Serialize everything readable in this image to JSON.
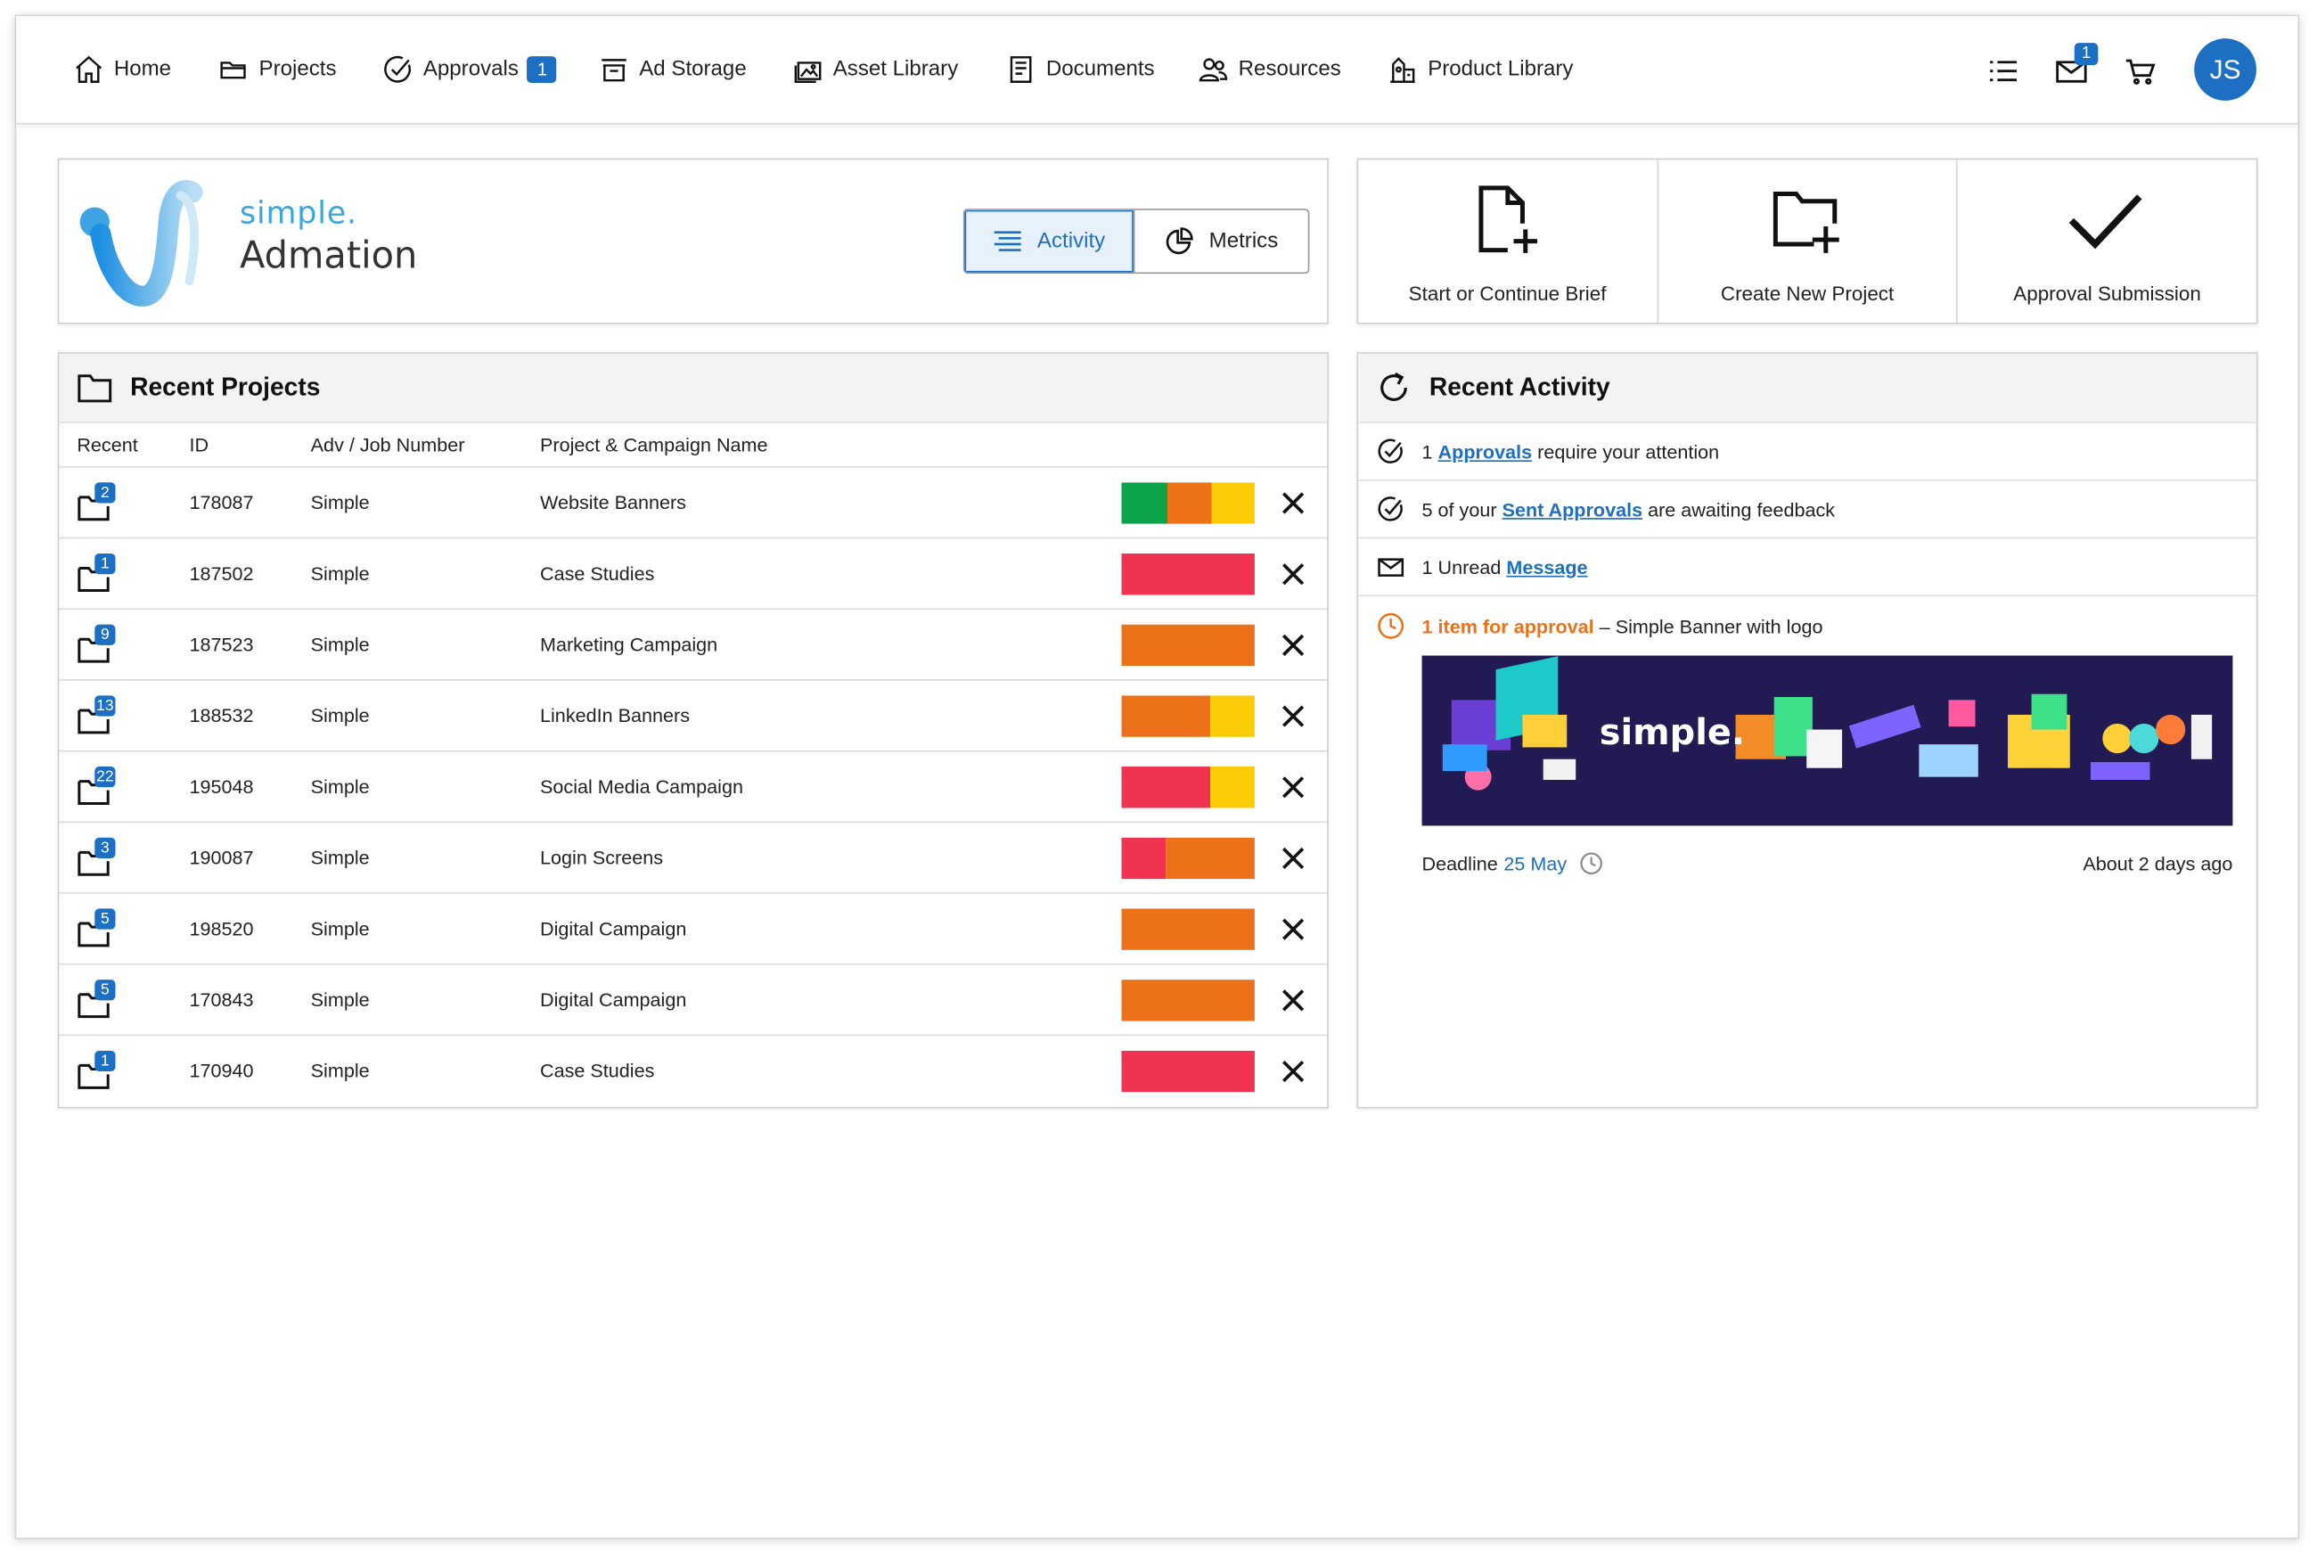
{
  "nav": {
    "items": [
      {
        "label": "Home",
        "icon": "home-icon"
      },
      {
        "label": "Projects",
        "icon": "folder-open-icon"
      },
      {
        "label": "Approvals",
        "icon": "check-circle-icon",
        "badge": "1"
      },
      {
        "label": "Ad Storage",
        "icon": "storage-box-icon"
      },
      {
        "label": "Asset Library",
        "icon": "image-stack-icon"
      },
      {
        "label": "Documents",
        "icon": "document-icon"
      },
      {
        "label": "Resources",
        "icon": "people-icon"
      },
      {
        "label": "Product Library",
        "icon": "product-icon"
      }
    ],
    "messages_badge": "1",
    "avatar_initials": "JS",
    "accent_color": "#1c6fc2"
  },
  "brand": {
    "word_top": "simple.",
    "word_bottom": "Admation"
  },
  "view_toggle": {
    "activity_label": "Activity",
    "metrics_label": "Metrics",
    "selected": "Activity"
  },
  "actions": [
    {
      "label": "Start or Continue Brief",
      "icon": "new-file-icon"
    },
    {
      "label": "Create New Project",
      "icon": "new-folder-icon"
    },
    {
      "label": "Approval Submission",
      "icon": "checkmark-icon"
    }
  ],
  "recent_projects": {
    "title": "Recent Projects",
    "columns": [
      "Recent",
      "ID",
      "Adv / Job Number",
      "Project & Campaign Name"
    ],
    "status_colors": {
      "green": "#0da34a",
      "orange": "#ec7118",
      "yellow": "#fccc06",
      "red": "#ef3351"
    },
    "rows": [
      {
        "badge": "2",
        "id": "178087",
        "adv": "Simple",
        "name": "Website Banners",
        "status": [
          {
            "color": "#0da34a",
            "share": 0.34
          },
          {
            "color": "#ec7118",
            "share": 0.33
          },
          {
            "color": "#fccc06",
            "share": 0.33
          }
        ]
      },
      {
        "badge": "1",
        "id": "187502",
        "adv": "Simple",
        "name": "Case Studies",
        "status": [
          {
            "color": "#ef3351",
            "share": 1
          }
        ]
      },
      {
        "badge": "9",
        "id": "187523",
        "adv": "Simple",
        "name": "Marketing Campaign",
        "status": [
          {
            "color": "#ec7118",
            "share": 1
          }
        ]
      },
      {
        "badge": "13",
        "id": "188532",
        "adv": "Simple",
        "name": "LinkedIn Banners",
        "status": [
          {
            "color": "#ec7118",
            "share": 0.67
          },
          {
            "color": "#fccc06",
            "share": 0.33
          }
        ]
      },
      {
        "badge": "22",
        "id": "195048",
        "adv": "Simple",
        "name": "Social Media Campaign",
        "status": [
          {
            "color": "#ef3351",
            "share": 0.67
          },
          {
            "color": "#fccc06",
            "share": 0.33
          }
        ]
      },
      {
        "badge": "3",
        "id": "190087",
        "adv": "Simple",
        "name": "Login Screens",
        "status": [
          {
            "color": "#ef3351",
            "share": 0.33
          },
          {
            "color": "#ec7118",
            "share": 0.67
          }
        ]
      },
      {
        "badge": "5",
        "id": "198520",
        "adv": "Simple",
        "name": "Digital Campaign",
        "status": [
          {
            "color": "#ec7118",
            "share": 1
          }
        ]
      },
      {
        "badge": "5",
        "id": "170843",
        "adv": "Simple",
        "name": "Digital Campaign",
        "status": [
          {
            "color": "#ec7118",
            "share": 1
          }
        ]
      },
      {
        "badge": "1",
        "id": "170940",
        "adv": "Simple",
        "name": "Case Studies",
        "status": [
          {
            "color": "#ef3351",
            "share": 1
          }
        ]
      }
    ]
  },
  "recent_activity": {
    "title": "Recent Activity",
    "approvals": {
      "count": "1",
      "link": "Approvals",
      "text": "require your attention"
    },
    "sent": {
      "prefix": "5 of your",
      "link": "Sent Approvals",
      "text": "are awaiting feedback"
    },
    "messages": {
      "prefix": "1 Unread",
      "link": "Message"
    },
    "approval_item": {
      "highlight": "1 item for approval",
      "dash": "–",
      "name": "Simple Banner with logo",
      "banner_word": "simple.",
      "deadline_label": "Deadline",
      "deadline_date": "25 May",
      "age": "About 2 days ago"
    }
  }
}
